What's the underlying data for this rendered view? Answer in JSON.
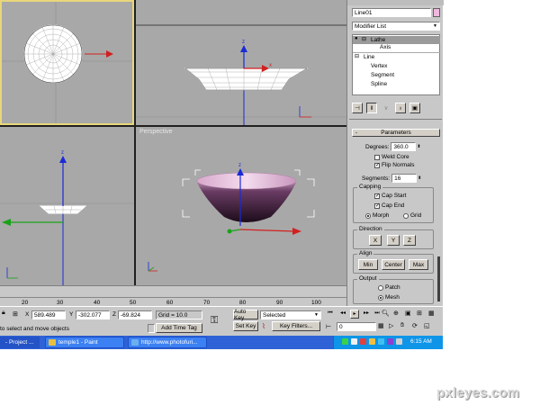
{
  "viewports": {
    "perspective_label": "Perspective"
  },
  "panel": {
    "object_name": "Line01",
    "modifier_list": "Modifier List",
    "stack": [
      {
        "label": "Lathe",
        "indent": 0,
        "selected": true
      },
      {
        "label": "Axis",
        "indent": 1,
        "selected": false
      },
      {
        "label": "Line",
        "indent": 0,
        "selected": false
      },
      {
        "label": "Vertex",
        "indent": 1,
        "selected": false
      },
      {
        "label": "Segment",
        "indent": 1,
        "selected": false
      },
      {
        "label": "Spline",
        "indent": 1,
        "selected": false
      }
    ],
    "parameters_title": "Parameters",
    "degrees_label": "Degrees:",
    "degrees_value": "360.0",
    "weld_core_label": "Weld Core",
    "flip_normals_label": "Flip Normals",
    "segments_label": "Segments:",
    "segments_value": "16",
    "capping_title": "Capping",
    "cap_start_label": "Cap Start",
    "cap_end_label": "Cap End",
    "morph_label": "Morph",
    "grid_label": "Grid",
    "direction_title": "Direction",
    "dir_x": "X",
    "dir_y": "Y",
    "dir_z": "Z",
    "align_title": "Align",
    "align_min": "Min",
    "align_center": "Center",
    "align_max": "Max",
    "output_title": "Output",
    "patch_label": "Patch",
    "mesh_label": "Mesh"
  },
  "timeline": {
    "ticks": [
      "20",
      "30",
      "40",
      "50",
      "60",
      "70",
      "80",
      "90",
      "100"
    ]
  },
  "status": {
    "prompt": "to select and move objects",
    "x_label": "X",
    "x_value": "589.489",
    "y_label": "Y",
    "y_value": "-302.077",
    "z_label": "Z",
    "z_value": "-69.824",
    "grid": "Grid = 10.0",
    "add_time_tag": "Add Time Tag",
    "auto_key": "Auto Key",
    "set_key": "Set Key",
    "selected": "Selected",
    "key_filters": "Key Filters...",
    "frame": "0"
  },
  "taskbar": {
    "items": [
      {
        "label": "- Project ..."
      },
      {
        "label": "temple1 - Paint"
      },
      {
        "label": "http://www.photofuri..."
      }
    ],
    "clock": "6:15 AM"
  },
  "watermark": "pxleyes.com",
  "colors": {
    "viewport_bg": "#a8a8a8",
    "active_border": "#e8d67a",
    "taskbar_blue": "#2f62d7",
    "tray_blue": "#0f95e8",
    "axis_red": "#d22020",
    "axis_green": "#1aa21a",
    "axis_blue": "#1a2ad6",
    "bowl_pink": "#c8a0c0"
  }
}
